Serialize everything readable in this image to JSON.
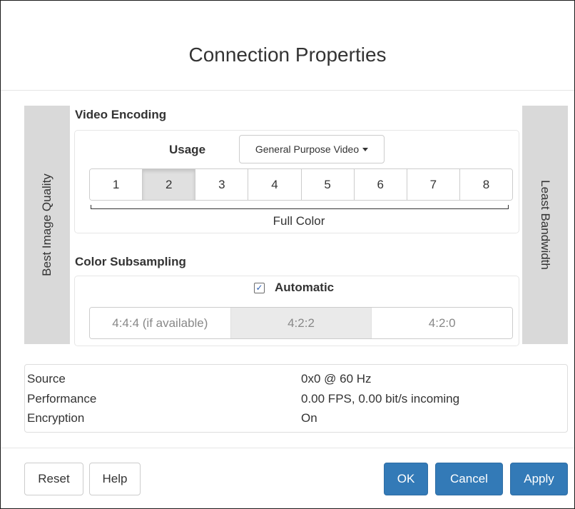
{
  "dialog": {
    "title": "Connection Properties"
  },
  "sides": {
    "left_label": "Best Image Quality",
    "right_label": "Least Bandwidth"
  },
  "video_encoding": {
    "heading": "Video Encoding",
    "usage_label": "Usage",
    "usage_selected": "General Purpose Video",
    "levels": [
      "1",
      "2",
      "3",
      "4",
      "5",
      "6",
      "7",
      "8"
    ],
    "selected_level": "2",
    "range_caption": "Full Color"
  },
  "color_subsampling": {
    "heading": "Color Subsampling",
    "automatic_label": "Automatic",
    "automatic_checked": true,
    "options": [
      "4:4:4 (if available)",
      "4:2:2",
      "4:2:0"
    ],
    "selected_option": "4:2:2"
  },
  "info": {
    "rows": [
      {
        "label": "Source",
        "value": "0x0 @ 60 Hz"
      },
      {
        "label": "Performance",
        "value": "0.00 FPS, 0.00 bit/s incoming"
      },
      {
        "label": "Encryption",
        "value": "On"
      }
    ]
  },
  "footer": {
    "reset_label": "Reset",
    "help_label": "Help",
    "ok_label": "OK",
    "cancel_label": "Cancel",
    "apply_label": "Apply"
  },
  "colors": {
    "primary": "#337ab7",
    "side_panel": "#d9d9d9",
    "selected_segment": "#e0e0e0"
  }
}
